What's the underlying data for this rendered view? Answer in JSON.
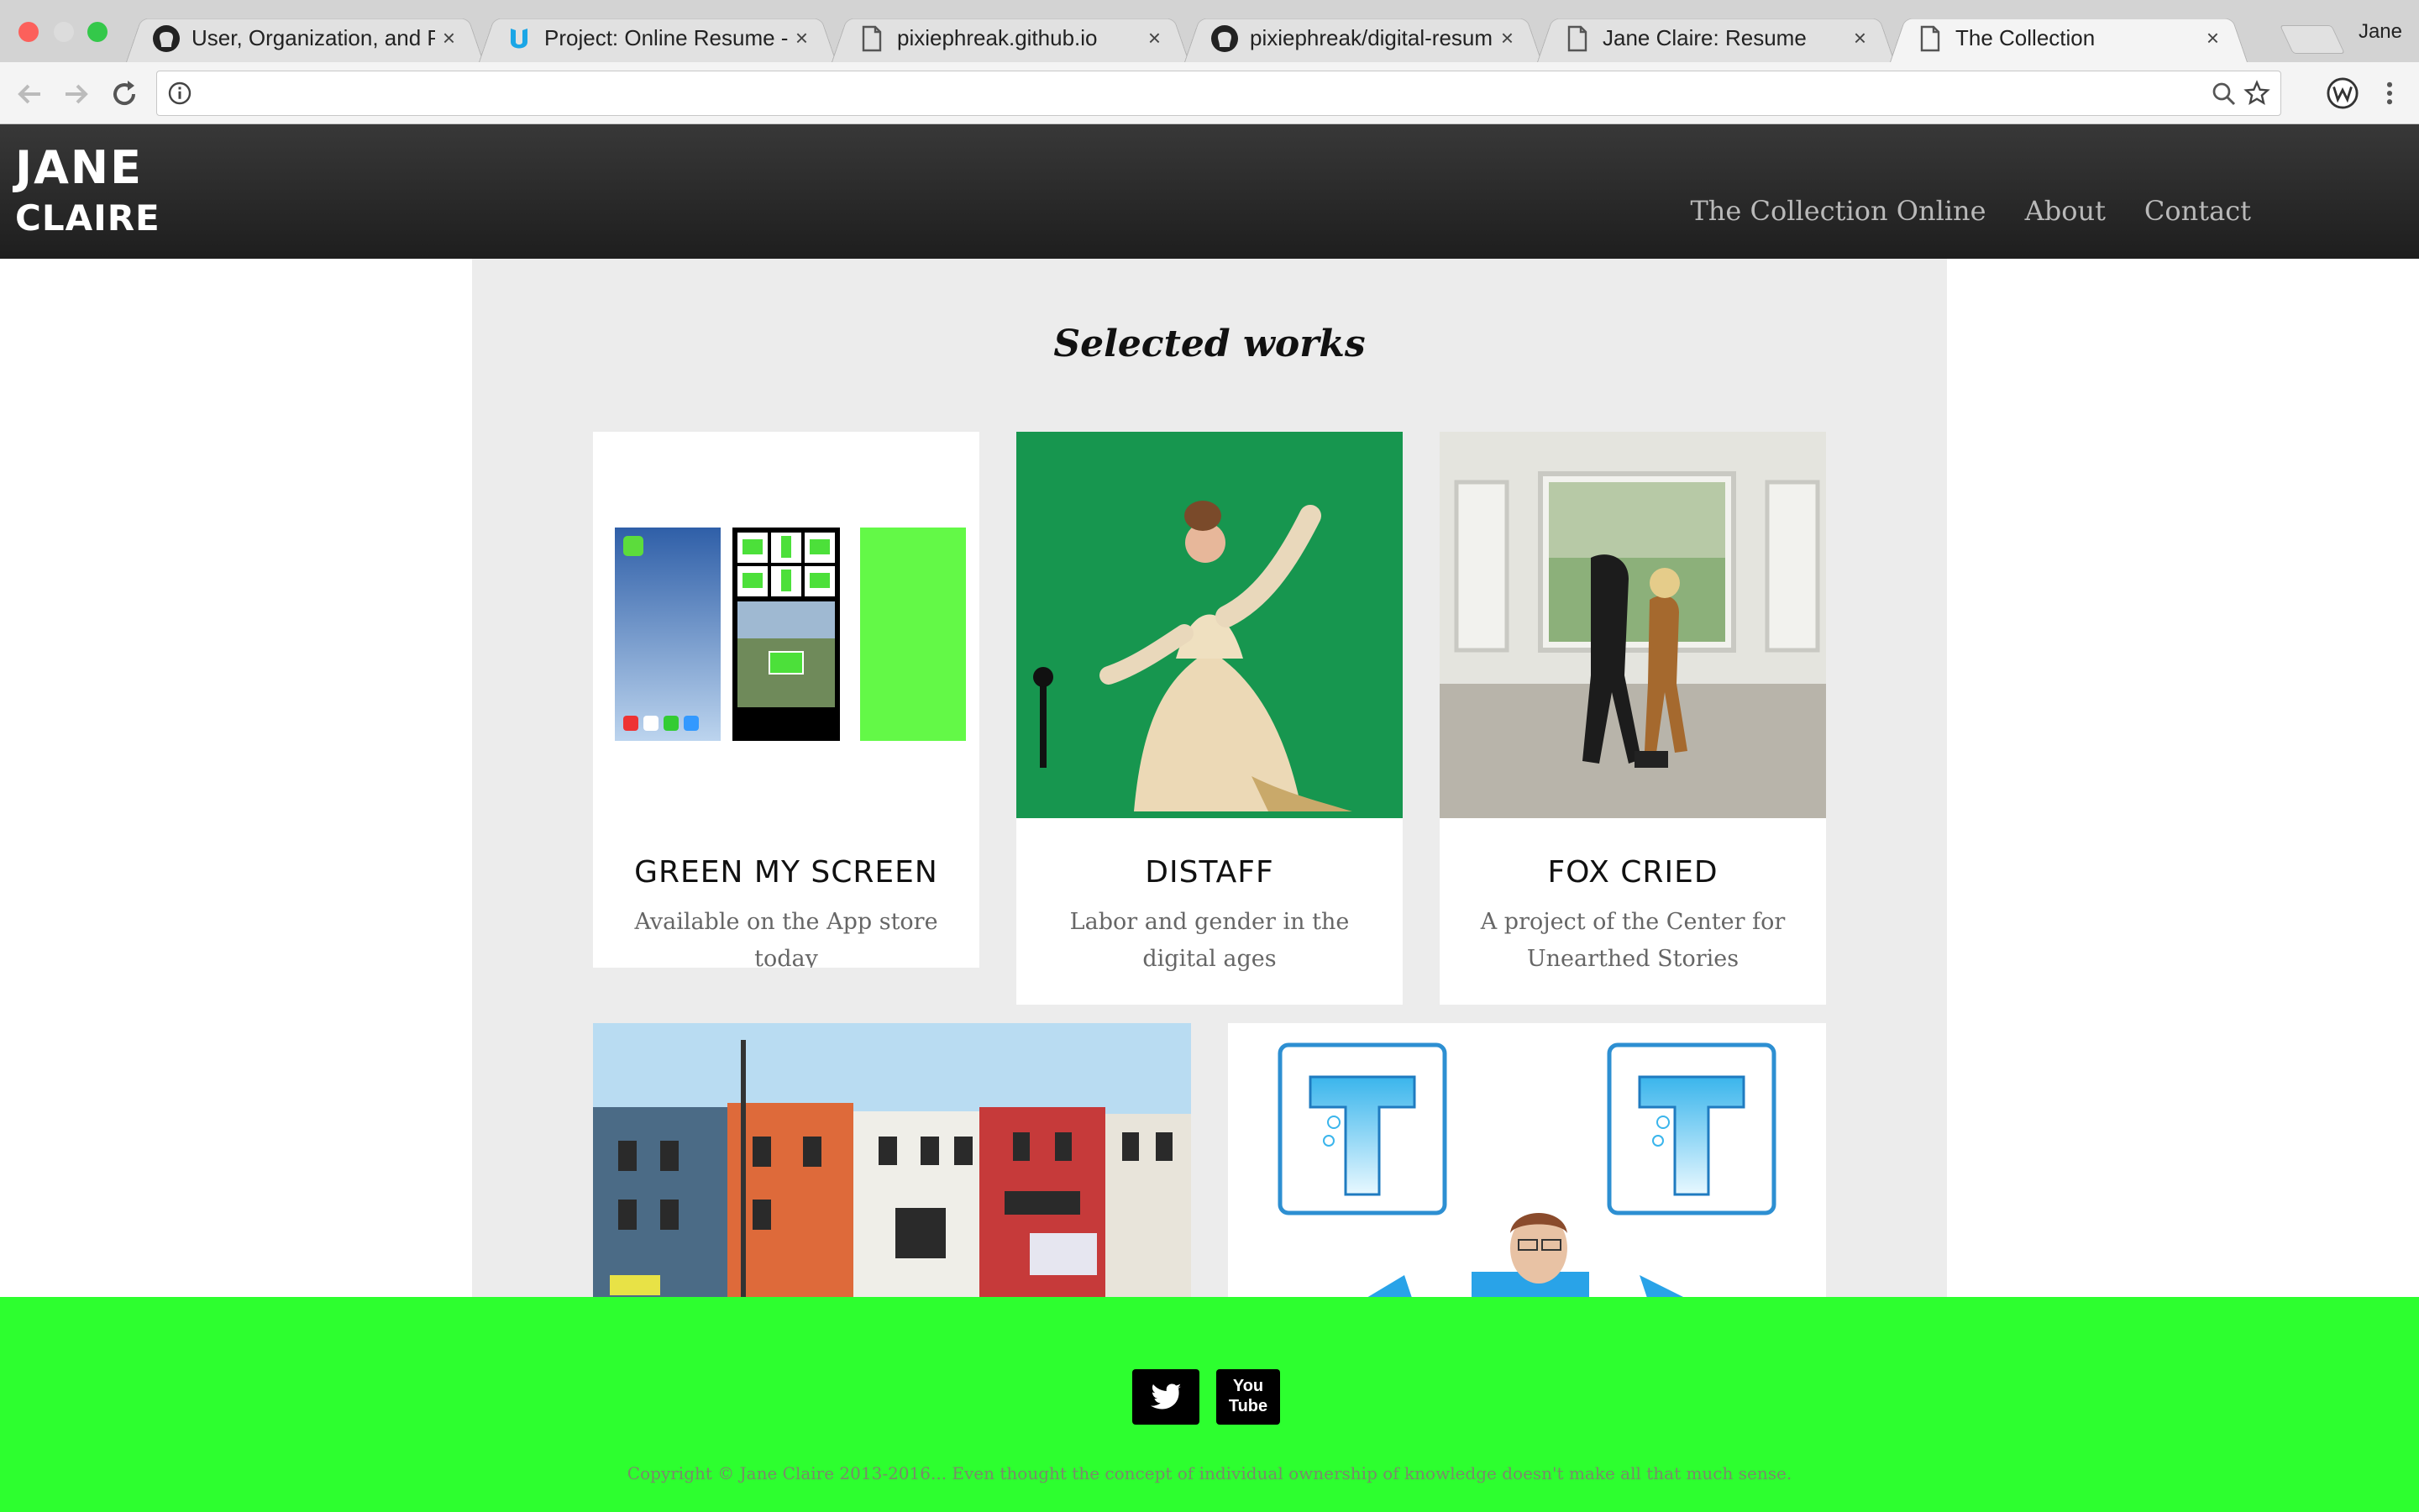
{
  "browser": {
    "tabs": [
      {
        "title": "User, Organization, and Pro",
        "icon": "github-icon",
        "active": false
      },
      {
        "title": "Project: Online Resume - Ud",
        "icon": "udacity-icon",
        "active": false
      },
      {
        "title": "pixiephreak.github.io",
        "icon": "page-icon",
        "active": false
      },
      {
        "title": "pixiephreak/digital-resume",
        "icon": "github-icon",
        "active": false
      },
      {
        "title": "Jane Claire: Resume",
        "icon": "page-icon",
        "active": false
      },
      {
        "title": "The Collection",
        "icon": "page-icon",
        "active": true
      }
    ],
    "tab_close": "×",
    "profile_name": "Jane",
    "address_value": "",
    "colors": {
      "close": "#fc605b",
      "minimize": "#dcdcdc",
      "maximize": "#34c84a"
    }
  },
  "site": {
    "logo_line1": "JANE",
    "logo_line2": "CLAIRE",
    "nav": [
      "The Collection Online",
      "About",
      "Contact"
    ]
  },
  "main": {
    "heading": "Selected works",
    "cards": [
      {
        "title": "GREEN MY SCREEN",
        "description": "Available on the App store today"
      },
      {
        "title": "DISTAFF",
        "description": "Labor and gender in the digital ages"
      },
      {
        "title": "FOX CRIED",
        "description": "A project of the Center for Unearthed Stories"
      }
    ]
  },
  "footer": {
    "accent": "#2dff2f",
    "social": [
      "twitter-icon",
      "youtube-icon"
    ],
    "youtube_text_top": "You",
    "youtube_text_bottom": "Tube",
    "copyright": "Copyright © Jane Claire 2013-2016... Even thought the concept of individual ownership of knowledge doesn't make all that much sense."
  }
}
